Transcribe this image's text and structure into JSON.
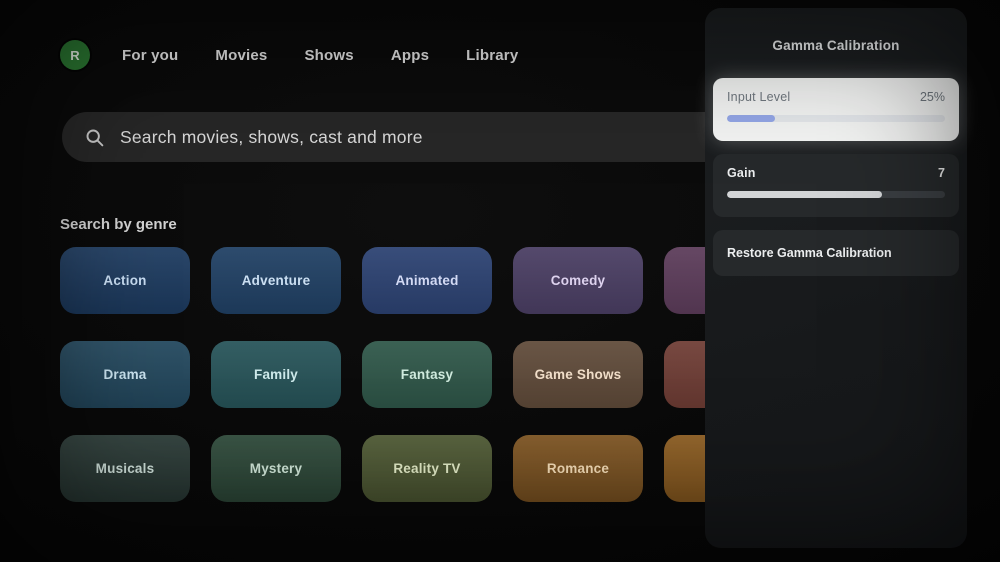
{
  "header": {
    "avatar_letter": "R",
    "nav_items": [
      "For you",
      "Movies",
      "Shows",
      "Apps",
      "Library"
    ]
  },
  "search": {
    "placeholder": "Search movies, shows, cast and more"
  },
  "genres": {
    "title": "Search by genre",
    "tiles": [
      {
        "label": "Action",
        "bg": "#1d3b60",
        "fg": "#c8ddf2"
      },
      {
        "label": "Adventure",
        "bg": "#204064",
        "fg": "#cbdff2"
      },
      {
        "label": "Animated",
        "bg": "#2c4272",
        "fg": "#d3daf4"
      },
      {
        "label": "Comedy",
        "bg": "#4a3e63",
        "fg": "#ddd2ee"
      },
      {
        "label": "",
        "bg": "#5c3c5a",
        "fg": "#eadcea"
      },
      {
        "label": "Drama",
        "bg": "#23485e",
        "fg": "#c9e2ee"
      },
      {
        "label": "Family",
        "bg": "#275459",
        "fg": "#cde9ea"
      },
      {
        "label": "Fantasy",
        "bg": "#2f5749",
        "fg": "#cfeadd"
      },
      {
        "label": "Game Shows",
        "bg": "#604b3a",
        "fg": "#f0ddc8"
      },
      {
        "label": "",
        "bg": "#6f3d35",
        "fg": "#f2d5cd"
      },
      {
        "label": "Musicals",
        "bg": "#2a3a36",
        "fg": "#cfe0da"
      },
      {
        "label": "Mystery",
        "bg": "#2e4a3a",
        "fg": "#d2e8da"
      },
      {
        "label": "Reality TV",
        "bg": "#4f5a34",
        "fg": "#e4ecc8"
      },
      {
        "label": "Romance",
        "bg": "#7f5522",
        "fg": "#f5ddb8"
      },
      {
        "label": "",
        "bg": "#8c5c20",
        "fg": "#f7e0ba"
      }
    ]
  },
  "panel": {
    "title": "Gamma Calibration",
    "input_level": {
      "label": "Input Level",
      "value": "25%",
      "progress": 22,
      "fill": "#93a6e6"
    },
    "gain": {
      "label": "Gain",
      "value": "7",
      "progress": 71,
      "fill": "#d2d4d6"
    },
    "restore": {
      "label": "Restore Gamma Calibration"
    }
  }
}
